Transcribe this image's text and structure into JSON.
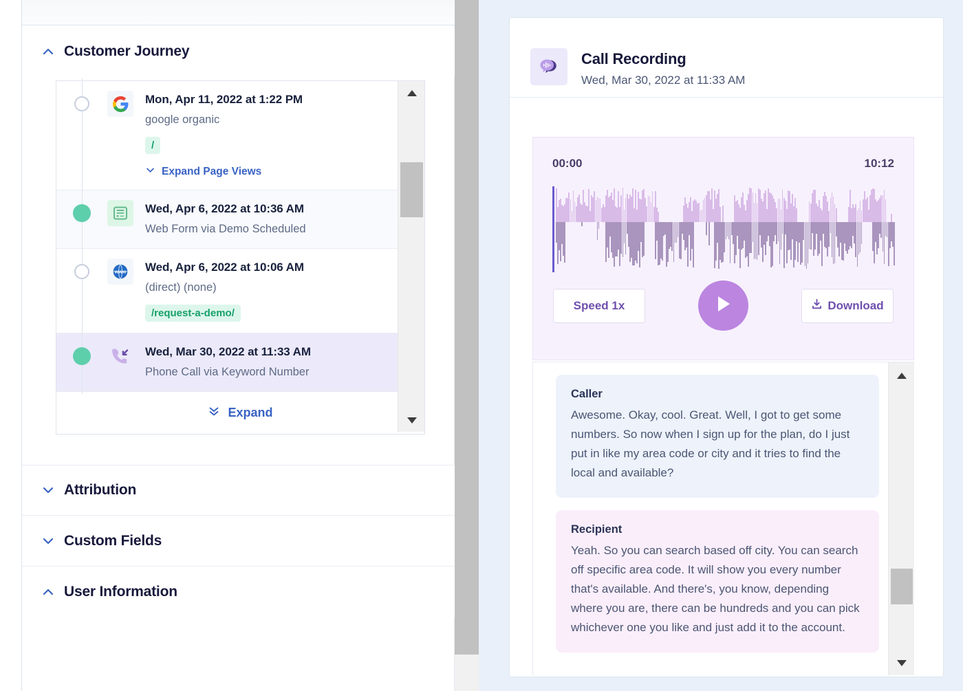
{
  "colors": {
    "accent_blue": "#3963c4",
    "green_dot": "#5ecfab",
    "purple": "#bb85e0",
    "panel_blue": "#e9f0f9",
    "chip_green_text": "#17a06a"
  },
  "left_panel": {
    "sections": [
      {
        "title": "Customer Journey",
        "state": "expanded",
        "caret": "chevron-up-icon"
      },
      {
        "title": "Attribution",
        "state": "collapsed",
        "caret": "chevron-down-icon"
      },
      {
        "title": "Custom Fields",
        "state": "collapsed",
        "caret": "chevron-down-icon"
      },
      {
        "title": "User Information",
        "state": "expanded",
        "caret": "chevron-up-icon"
      }
    ],
    "journey": {
      "items": [
        {
          "date": "Mon, Apr 11, 2022 at 1:22 PM",
          "source": "google organic",
          "chip": "/",
          "link": "Expand Page Views",
          "link_icon": "chevron-down-icon",
          "icon": "google-icon",
          "dot": "hollow",
          "row_style": "plain"
        },
        {
          "date": "Wed, Apr 6, 2022 at 10:36 AM",
          "source": "Web Form via Demo Scheduled",
          "chip": null,
          "link": null,
          "icon": "web-form-icon",
          "dot": "filled",
          "row_style": "shaded"
        },
        {
          "date": "Wed, Apr 6, 2022 at 10:06 AM",
          "source": "(direct) (none)",
          "chip": "/request-a-demo/",
          "link": null,
          "icon": "www-globe-icon",
          "dot": "hollow",
          "row_style": "plain"
        },
        {
          "date": "Wed, Mar 30, 2022 at 11:33 AM",
          "source": "Phone Call via Keyword Number",
          "chip": null,
          "link": null,
          "icon": "inbound-call-icon",
          "dot": "filled",
          "row_style": "selected"
        }
      ],
      "expand_label": "Expand",
      "expand_icon": "double-chevron-down-icon"
    }
  },
  "right_panel": {
    "card": {
      "icon": "call-recording-bubble-icon",
      "title": "Call Recording",
      "date": "Wed, Mar 30, 2022 at 11:33 AM"
    },
    "player": {
      "time_start": "00:00",
      "time_end": "10:12",
      "speed_label": "Speed 1x",
      "play_label": "play-button",
      "play_icon": "play-triangle-icon",
      "download_label": "Download",
      "download_icon": "download-icon",
      "playhead_position_pct": 0
    },
    "transcript": {
      "messages": [
        {
          "speaker": "Caller",
          "text": "Awesome. Okay, cool. Great. Well, I got to get some numbers. So now when I sign up for the plan, do I just put in like my area code or city and it tries to find the local and available?",
          "style": "caller"
        },
        {
          "speaker": "Recipient",
          "text": "Yeah. So you can search based off city. You can search off specific area code. It will show you every number that's available. And there's, you know, depending where you are, there can be hundreds and you can pick whichever one you like and just add it to the account.",
          "style": "recipient"
        }
      ],
      "scroll_up_icon": "triangle-up-icon",
      "scroll_down_icon": "triangle-down-icon"
    }
  }
}
